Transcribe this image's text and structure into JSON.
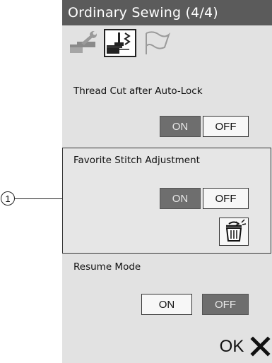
{
  "screen": {
    "title": "Ordinary Sewing (4/4)"
  },
  "tabs": [
    {
      "icon": "wrench-icon",
      "selected": false
    },
    {
      "icon": "presser-foot-icon",
      "selected": true
    },
    {
      "icon": "flag-icon",
      "selected": false
    }
  ],
  "settings": {
    "thread_cut": {
      "label": "Thread Cut after Auto-Lock",
      "on_label": "ON",
      "off_label": "OFF",
      "value": "ON"
    },
    "favorite_stitch": {
      "label": "Favorite Stitch Adjustment",
      "on_label": "ON",
      "off_label": "OFF",
      "value": "ON"
    },
    "resume_mode": {
      "label": "Resume Mode",
      "on_label": "ON",
      "off_label": "OFF",
      "value": "OFF"
    }
  },
  "callout": {
    "number": "1"
  },
  "footer": {
    "ok_label": "OK"
  },
  "colors": {
    "title_bar": "#5b5b5b",
    "panel": "#e2e2e2",
    "active_button": "#6e6e6e",
    "idle_button": "#f7f7f7"
  }
}
